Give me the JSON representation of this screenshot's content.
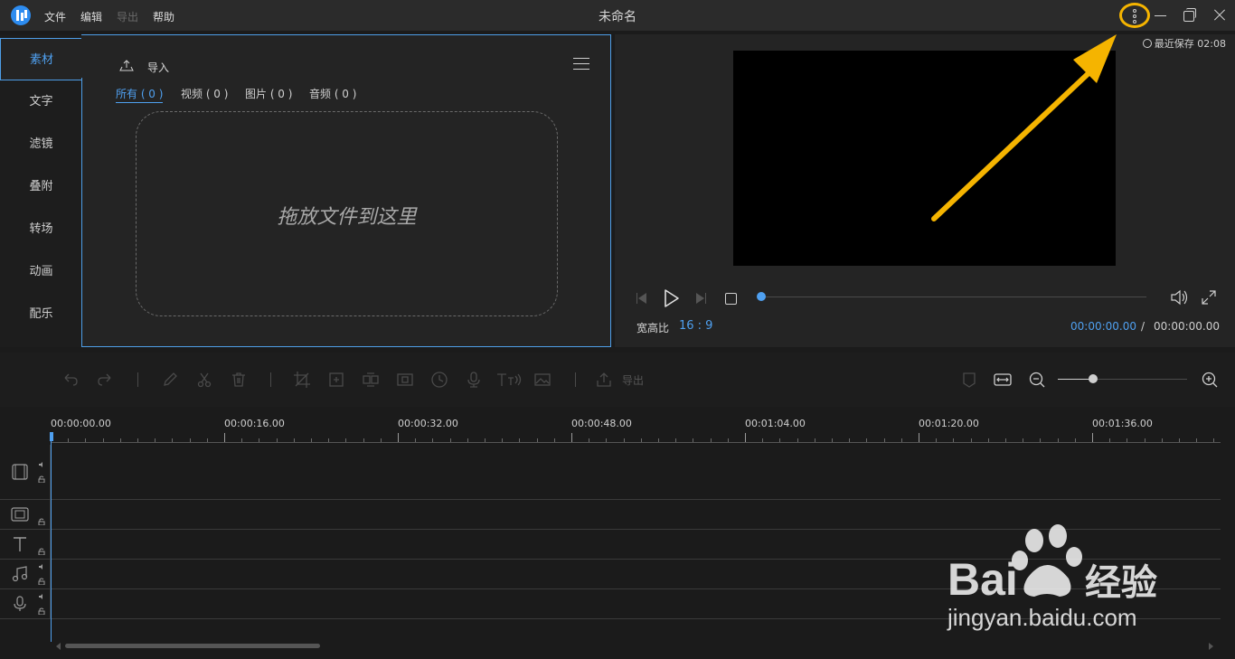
{
  "window": {
    "title": "未命名",
    "menu": [
      "文件",
      "编辑",
      "导出",
      "帮助"
    ],
    "saved_status": "最近保存 02:08"
  },
  "sidebar": {
    "items": [
      {
        "label": "素材",
        "active": true
      },
      {
        "label": "文字"
      },
      {
        "label": "滤镜"
      },
      {
        "label": "叠附"
      },
      {
        "label": "转场"
      },
      {
        "label": "动画"
      },
      {
        "label": "配乐"
      }
    ]
  },
  "media": {
    "import_label": "导入",
    "tabs": [
      {
        "label": "所有 ( 0 )",
        "active": true
      },
      {
        "label": "视频 ( 0 )"
      },
      {
        "label": "图片 ( 0 )"
      },
      {
        "label": "音频 ( 0 )"
      }
    ],
    "drop_text": "拖放文件到这里"
  },
  "preview": {
    "aspect_label": "宽高比",
    "aspect_value": "16 : 9",
    "time_current": "00:00:00.00",
    "time_separator": "/",
    "time_total": "00:00:00.00",
    "progress": 0.0
  },
  "toolbar": {
    "export_label": "导出",
    "zoom_level": 0.27
  },
  "timeline": {
    "ruler_labels": [
      "00:00:00.00",
      "00:00:16.00",
      "00:00:32.00",
      "00:00:48.00",
      "00:01:04.00",
      "00:01:20.00",
      "00:01:36.00"
    ]
  },
  "watermark": {
    "brand": "Bai",
    "brand_suffix": "经验",
    "url": "jingyan.baidu.com"
  },
  "colors": {
    "accent": "#4fa0f0",
    "highlight": "#f5b400",
    "background": "#1b1b1b",
    "panel": "#242424"
  }
}
